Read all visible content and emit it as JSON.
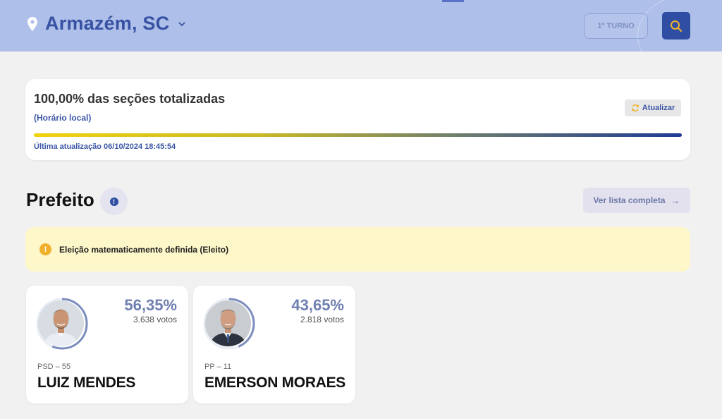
{
  "header": {
    "location": "Armazém, SC",
    "icons": {
      "location": "map-pin-icon",
      "dropdown": "chevron-down-icon",
      "search": "search-icon"
    },
    "round_label": "1º TURNO"
  },
  "status": {
    "title": "100,00% das seções totalizadas",
    "subtitle": "(Horário local)",
    "refresh_label": "Atualizar",
    "progress_fraction": 1.0,
    "last_update": "Última atualização 06/10/2024 18:45:54"
  },
  "section": {
    "title": "Prefeito",
    "list_button": "Ver lista completa",
    "list_arrow": "→"
  },
  "notice": {
    "icon": "!",
    "text": "Eleição matematicamente definida (Eleito)"
  },
  "candidates": [
    {
      "pct": "56,35%",
      "share": 0.5635,
      "votes": "3.638 votos",
      "party": "PSD – 55",
      "name": "LUIZ MENDES"
    },
    {
      "pct": "43,65%",
      "share": 0.4365,
      "votes": "2.818 votos",
      "party": "PP – 11",
      "name": "EMERSON MORAES"
    }
  ],
  "colors": {
    "header_bg": "#aebfe9",
    "accent_blue": "#2f4ea3",
    "search_icon": "#f0b02c",
    "notice_bg": "#fdf7c9",
    "ring": "#7c8dbd"
  }
}
